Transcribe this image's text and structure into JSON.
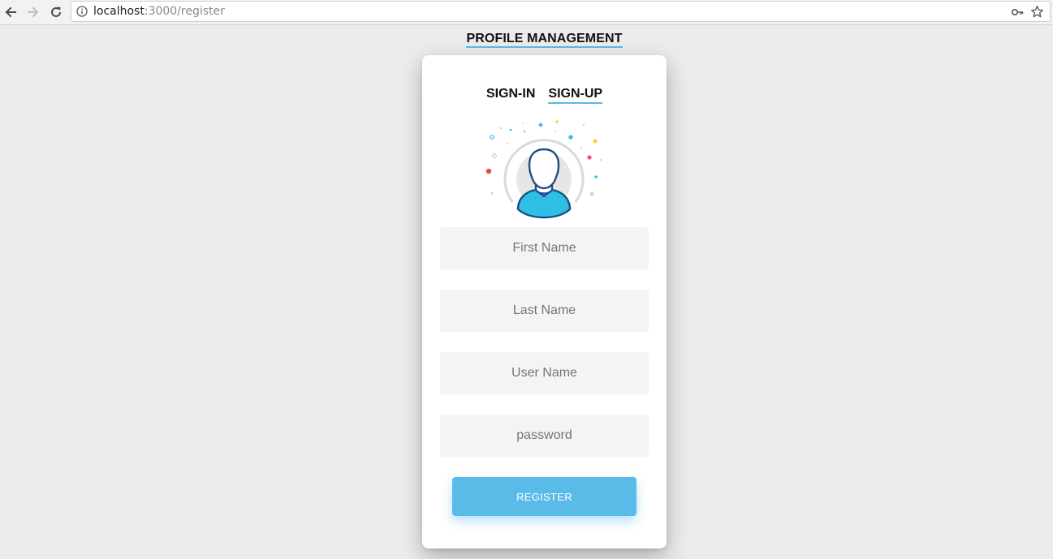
{
  "browser": {
    "url_host": "localhost",
    "url_path": ":3000/register",
    "icons": [
      "back-arrow-icon",
      "forward-arrow-icon",
      "reload-icon",
      "info-icon",
      "key-icon",
      "star-icon"
    ]
  },
  "page": {
    "title": "PROFILE MANAGEMENT"
  },
  "card": {
    "tabs": [
      {
        "label": "SIGN-IN",
        "active": false
      },
      {
        "label": "SIGN-UP",
        "active": true
      }
    ],
    "fields": [
      {
        "placeholder": "First Name",
        "value": ""
      },
      {
        "placeholder": "Last Name",
        "value": ""
      },
      {
        "placeholder": "User Name",
        "value": ""
      },
      {
        "placeholder": "password",
        "value": ""
      }
    ],
    "submit_label": "REGISTER"
  },
  "colors": {
    "accent": "#5abbe9",
    "background": "#ececec",
    "field_bg": "#f4f4f4",
    "avatar_body": "#2ec0e4",
    "avatar_outline": "#1f4e86"
  }
}
